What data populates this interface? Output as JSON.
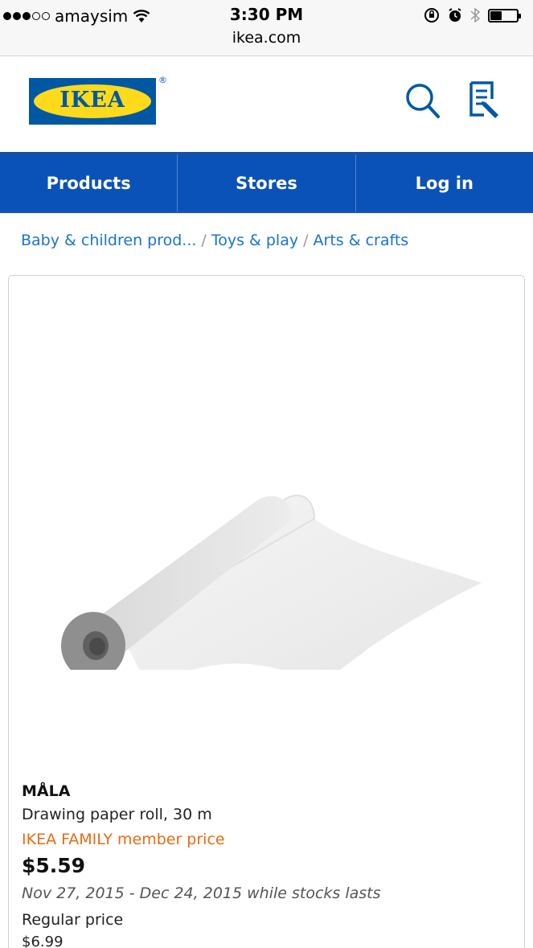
{
  "status_bar": {
    "carrier": "amaysim",
    "time": "3:30 PM",
    "url": "ikea.com"
  },
  "header": {
    "logo_text": "IKEA",
    "logo_registered": "®",
    "icons": [
      "search-icon",
      "shopping-list-icon"
    ]
  },
  "nav": {
    "items": [
      {
        "label": "Products"
      },
      {
        "label": "Stores"
      },
      {
        "label": "Log in"
      }
    ]
  },
  "breadcrumb": {
    "items": [
      "Baby & children prod...",
      "Toys & play",
      "Arts & crafts"
    ],
    "separator": "/"
  },
  "product": {
    "name": "MÅLA",
    "description": "Drawing paper roll, 30 m",
    "family_label": "IKEA FAMILY member price",
    "family_price": "$5.59",
    "offer_dates": "Nov 27, 2015 - Dec 24, 2015 while stocks lasts",
    "regular_label": "Regular price",
    "regular_price": "$6.99"
  },
  "colors": {
    "brand_blue": "#0058a3",
    "brand_yellow": "#ffda1a",
    "nav_blue": "#0b52b8",
    "link_blue": "#1a73d1",
    "family_orange": "#e96b12"
  }
}
